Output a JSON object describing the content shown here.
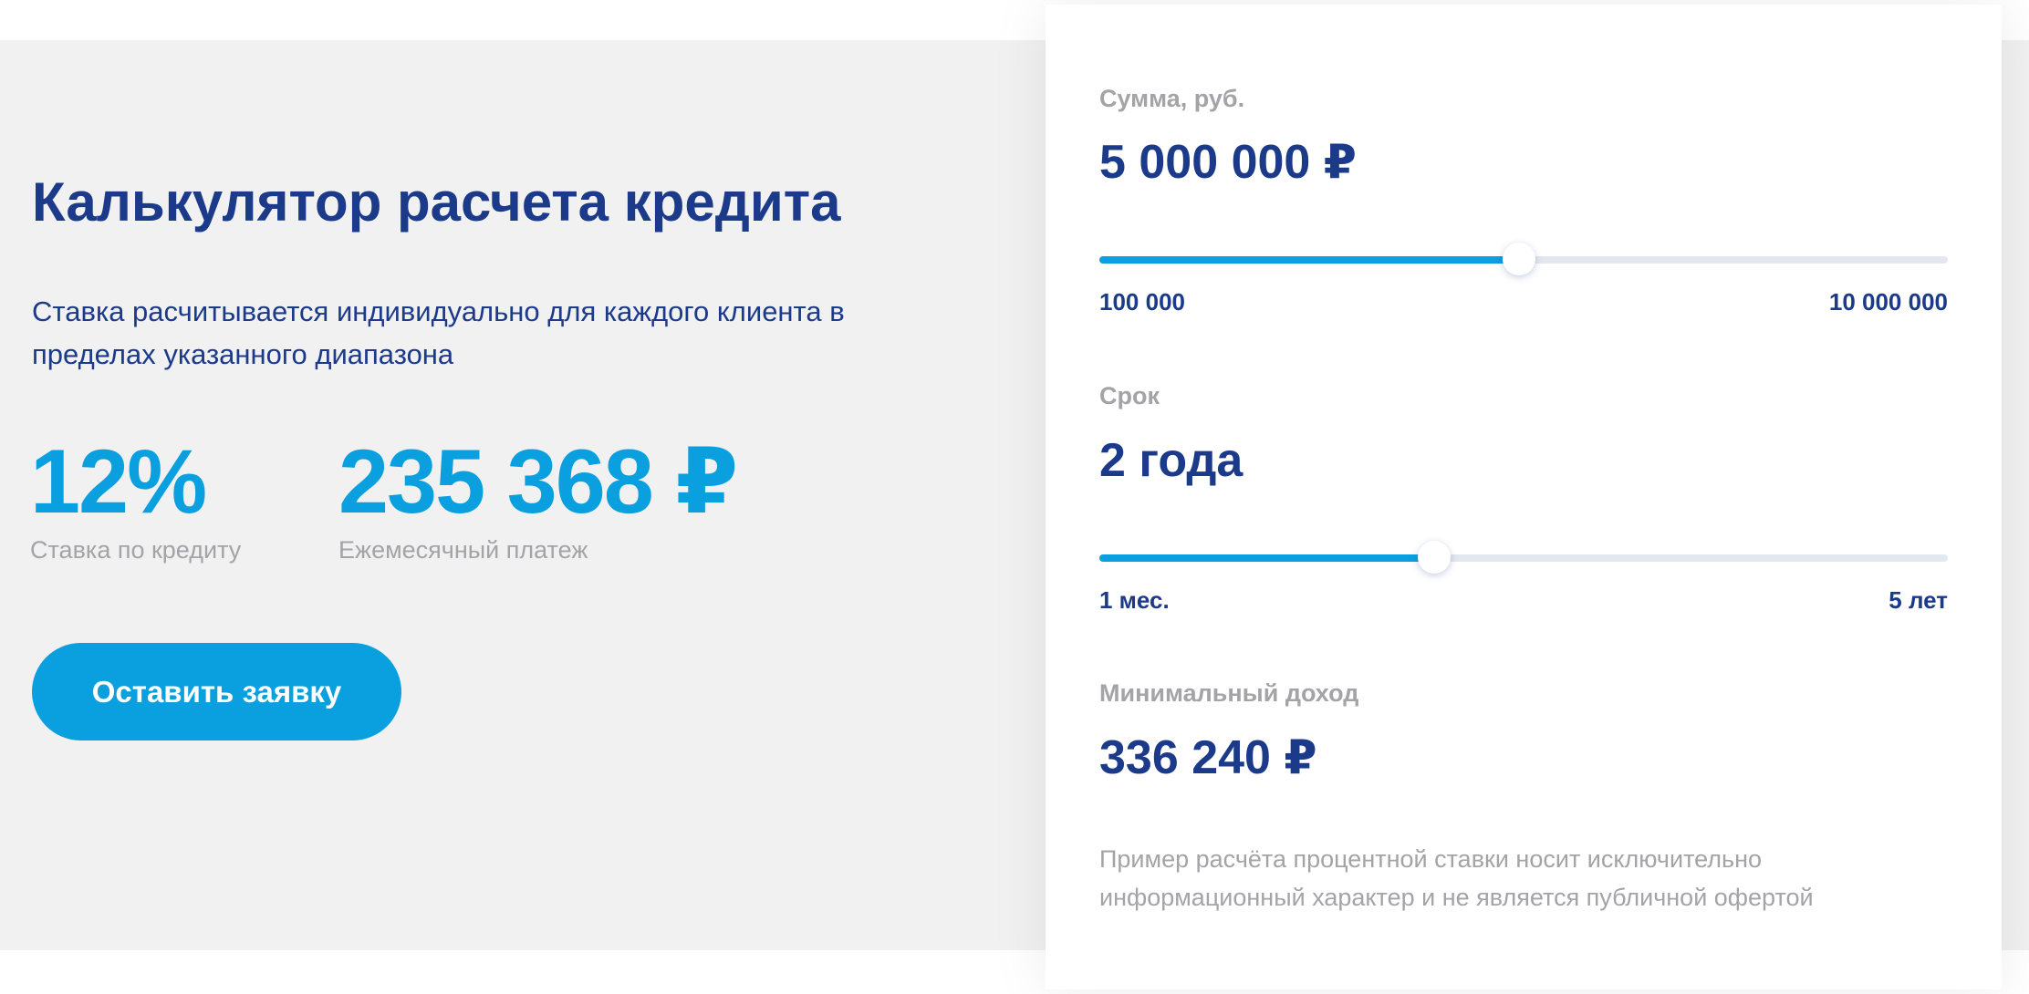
{
  "calculator": {
    "title": "Калькулятор расчета кредита",
    "subtitle": "Ставка расчитывается индивидуально для каждого клиента в пределах указанного диапазона",
    "rate": {
      "value": "12%",
      "label": "Ставка по кредиту"
    },
    "payment": {
      "value": "235 368 ₽",
      "label": "Ежемесячный платеж"
    },
    "apply_button_label": "Оставить заявку"
  },
  "form": {
    "amount": {
      "label": "Сумма, руб.",
      "value": "5 000 000 ₽",
      "min_label": "100 000",
      "max_label": "10 000 000",
      "position": 0.495
    },
    "term": {
      "label": "Срок",
      "value": "2 года",
      "min_label": "1 мес.",
      "max_label": "5 лет",
      "position": 0.395
    },
    "income": {
      "label": "Минимальный доход",
      "value": "336 240 ₽"
    },
    "disclaimer": "Пример расчёта процентной ставки носит исключительно информационный характер и не является публичной офертой"
  },
  "colors": {
    "primary": "#0aa0e0",
    "heading": "#1c3a8a",
    "muted": "#a3a3a8",
    "band": "#f1f1f2",
    "track": "#e3e7ee"
  }
}
